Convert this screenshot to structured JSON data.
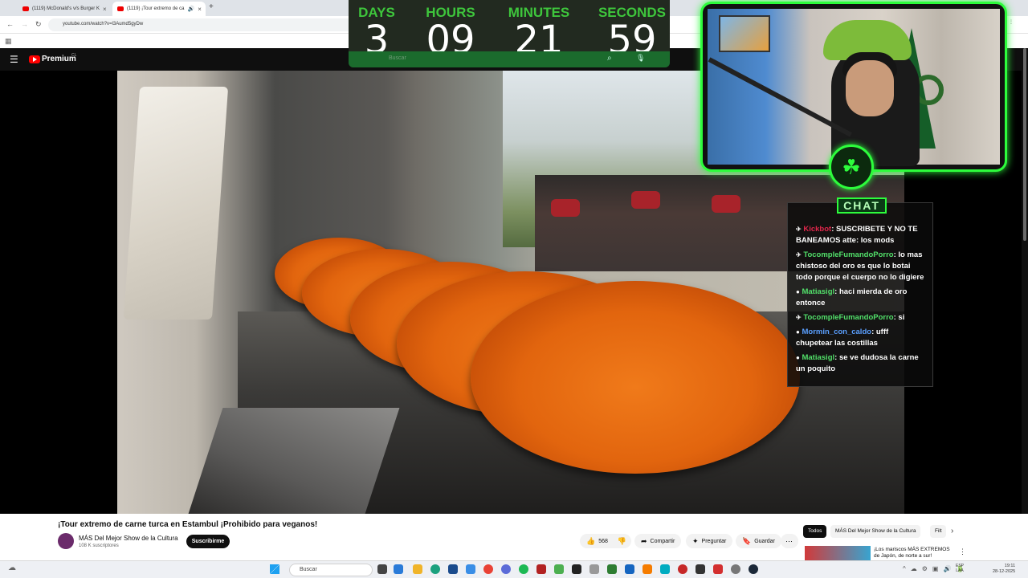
{
  "browser": {
    "tabs": [
      {
        "title": "(1119) McDonald's v/s Burger K",
        "active": false
      },
      {
        "title": "(1119) ¡Tour extremo de ca",
        "active": true
      }
    ],
    "url": "youtube.com/watch?v=l3Aumd5gyDw"
  },
  "youtube": {
    "brand": "Premium",
    "region": "CL",
    "search_placeholder": "Buscar"
  },
  "countdown": {
    "days_label": "DAYS",
    "days": "3",
    "hours_label": "HOURS",
    "hours": "09",
    "minutes_label": "MINUTES",
    "minutes": "21",
    "seconds_label": "SECONDS",
    "seconds": "59",
    "accent": "#3ec63c"
  },
  "overlay": {
    "frame_color": "#2dfc3c",
    "chat_label": "CHAT",
    "chat": [
      {
        "user": "Kickbot",
        "color": "#e0264b",
        "text": "SUSCRIBETE Y NO TE BANEAMOS atte: los mods"
      },
      {
        "user": "TocompleFumandoPorro",
        "color": "#52e06a",
        "text": "lo mas chistoso del oro es que lo botai todo porque el cuerpo no lo digiere"
      },
      {
        "user": "Matiasigl",
        "color": "#52e06a",
        "text": "haci mierda de oro entonce"
      },
      {
        "user": "TocompleFumandoPorro",
        "color": "#52e06a",
        "text": "si"
      },
      {
        "user": "Mormin_con_caldo",
        "color": "#5aa0ff",
        "text": "ufff chupetear las costillas"
      },
      {
        "user": "Matiasigl",
        "color": "#52e06a",
        "text": "se ve dudosa la carne un poquito"
      }
    ]
  },
  "video_info": {
    "title": "¡Tour extremo de carne turca en Estambul ¡Prohibido para veganos!",
    "channel": "MÁS Del Mejor Show de la Cultura",
    "subscribers": "108 K suscriptores",
    "subscribe_label": "Suscribirme",
    "likes": "568",
    "share_label": "Compartir",
    "ask_label": "Preguntar",
    "save_label": "Guardar"
  },
  "recommendations": {
    "chips": [
      "Todos",
      "MÁS Del Mejor Show de la Cultura",
      "Filt"
    ],
    "first_title": "¡Los mariscos MÁS EXTREMOS de Japón, de norte a sur!"
  },
  "taskbar": {
    "search_placeholder": "Buscar",
    "lang": "ESP",
    "lang_sub": "LAA",
    "time": "19:11",
    "date": "28-12-2025"
  }
}
